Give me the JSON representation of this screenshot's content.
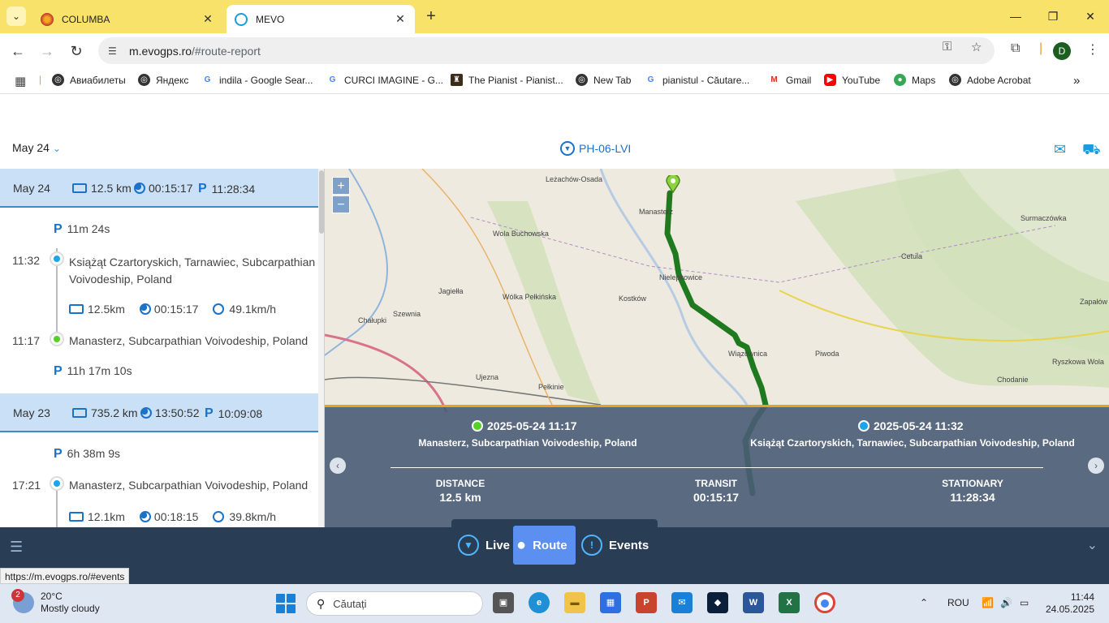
{
  "browser": {
    "tabs": [
      {
        "title": "COLUMBA",
        "active": false
      },
      {
        "title": "MEVO",
        "active": true
      }
    ],
    "url_host": "m.evogps.ro",
    "url_path": "/#route-report",
    "avatar_letter": "D",
    "bookmarks": [
      "Авиабилеты",
      "Яндекс",
      "indila - Google Sear...",
      "CURCI IMAGINE - G...",
      "The Pianist - Pianist...",
      "New Tab",
      "pianistul - Căutare...",
      "Gmail",
      "YouTube",
      "Maps",
      "Adobe Acrobat"
    ]
  },
  "header": {
    "date_select": "May 24",
    "vehicle": "PH-06-LVI"
  },
  "days": [
    {
      "date": "May 24",
      "distance": "12.5 km",
      "duration": "00:15:17",
      "parking": "11:28:34",
      "first_park": "11m 24s",
      "stop1_time": "11:32",
      "stop1_place": "Książąt Czartoryskich, Tarnawiec, Subcarpathian Voivodeship, Poland",
      "trip_distance": "12.5km",
      "trip_duration": "00:15:17",
      "trip_speed": "49.1km/h",
      "stop2_time": "11:17",
      "stop2_place": "Manasterz, Subcarpathian Voivodeship, Poland",
      "last_park": "11h 17m 10s"
    },
    {
      "date": "May 23",
      "distance": "735.2 km",
      "duration": "13:50:52",
      "parking": "10:09:08",
      "first_park": "6h 38m 9s",
      "stop1_time": "17:21",
      "stop1_place": "Manasterz, Subcarpathian Voivodeship, Poland",
      "trip_distance": "12.1km",
      "trip_duration": "00:18:15",
      "trip_speed": "39.8km/h"
    }
  ],
  "map": {
    "labels": [
      "Leżachów-Osada",
      "Manasterz",
      "Wola Buchowska",
      "Surmaczówka",
      "Cetula",
      "Zapałów",
      "Jagiełła",
      "Wólka Pełkińska",
      "Kostków",
      "Nielepkowice",
      "Szewnia",
      "Chałupki",
      "Wiązownica",
      "Piwoda",
      "Ryszkowa Wola",
      "Chodanie",
      "Ujezna",
      "Pełkinie"
    ],
    "zoom_in": "+",
    "zoom_out": "−"
  },
  "route_info": {
    "start_datetime": "2025-05-24 11:17",
    "start_place": "Manasterz, Subcarpathian Voivodeship, Poland",
    "end_datetime": "2025-05-24 11:32",
    "end_place": "Książąt Czartoryskich, Tarnawiec, Subcarpathian Voivodeship, Poland",
    "distance_label": "DISTANCE",
    "distance_value": "12.5 km",
    "transit_label": "TRANSIT",
    "transit_value": "00:15:17",
    "stationary_label": "STATIONARY",
    "stationary_value": "11:28:34"
  },
  "bottom_nav": {
    "tabs": [
      "Live",
      "Route",
      "Events"
    ],
    "active": "Route",
    "status_url": "https://m.evogps.ro/#events"
  },
  "taskbar": {
    "weather_badge": "2",
    "temperature": "20°C",
    "condition": "Mostly cloudy",
    "search_placeholder": "Căutați",
    "language": "ROU",
    "time": "11:44",
    "date": "24.05.2025"
  },
  "colors": {
    "accent": "#1a72c9",
    "route": "#1f7a1f",
    "nav_bg": "#293d55",
    "tab_strip": "#f8e26a"
  }
}
